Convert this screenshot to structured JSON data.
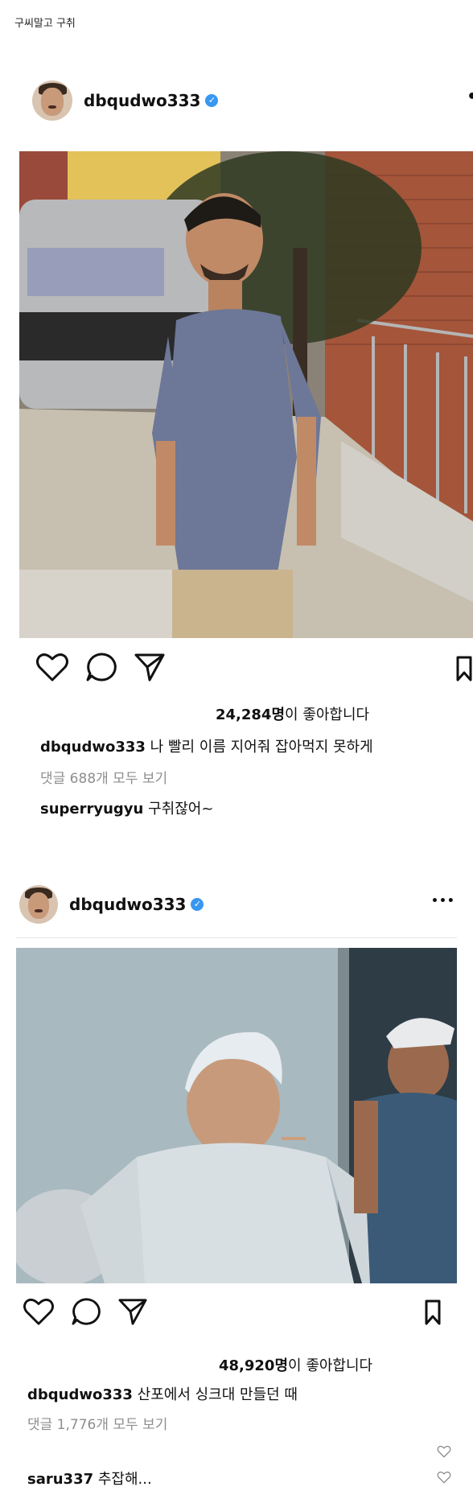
{
  "page_caption": "구씨말고 구취",
  "posts": [
    {
      "username": "dbqudwo333",
      "likes_count": "24,284명",
      "likes_suffix": "이 좋아합니다",
      "caption_user": "dbqudwo333",
      "caption_text": "나 빨리 이름 지어줘 잡아먹지 못하게",
      "comments_link": "댓글 688개 모두 보기",
      "comment_user": "superryugyu",
      "comment_text": "구취잖어~"
    },
    {
      "username": "dbqudwo333",
      "likes_count": "48,920명",
      "likes_suffix": "이 좋아합니다",
      "caption_user": "dbqudwo333",
      "caption_text": "산포에서 싱크대 만들던 때",
      "comments_link": "댓글 1,776개 모두 보기",
      "comment_user": "saru337",
      "comment_text": "추잡해..."
    }
  ],
  "icons": {
    "verified": "verified-badge-icon",
    "more": "more-icon",
    "like": "heart-icon",
    "comment": "comment-icon",
    "share": "share-icon",
    "save": "bookmark-icon"
  },
  "colors": {
    "verified": "#3897f0",
    "muted_text": "#8e8e8e"
  },
  "glyphs": {
    "verified_mark": "✓",
    "more_dots": "•••"
  }
}
